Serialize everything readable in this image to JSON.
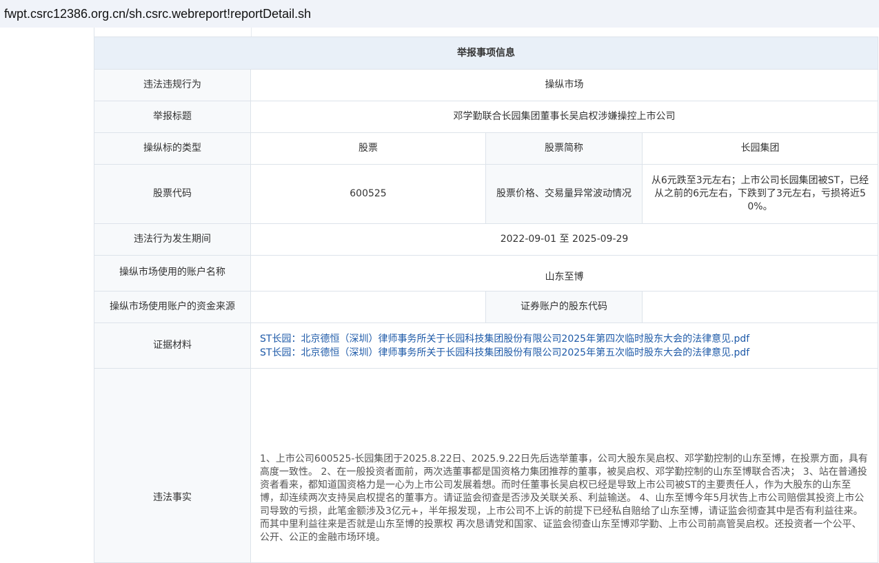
{
  "browser": {
    "url": "fwpt.csrc12386.org.cn/sh.csrc.webreport!reportDetail.sh"
  },
  "report": {
    "section_title": "举报事项信息",
    "violation_type": {
      "label": "违法违规行为",
      "value": "操纵市场"
    },
    "title": {
      "label": "举报标题",
      "value": "邓学勤联合长园集团董事长吴启权涉嫌操控上市公司"
    },
    "target_type": {
      "label": "操纵标的类型",
      "value": "股票",
      "abbr_label": "股票简称",
      "abbr_value": "长园集团"
    },
    "stock_code": {
      "label": "股票代码",
      "value": "600525",
      "anomaly_label": "股票价格、交易量异常波动情况",
      "anomaly_value": "从6元跌至3元左右；上市公司长园集团被ST，已经从之前的6元左右，下跌到了3元左右，亏损将近50%。"
    },
    "period": {
      "label": "违法行为发生期间",
      "value": "2022-09-01 至 2025-09-29"
    },
    "account_name": {
      "label": "操纵市场使用的账户名称",
      "value": "山东至博"
    },
    "fund_source": {
      "label": "操纵市场使用账户的资金来源",
      "value": "",
      "holder_code_label": "证券账户的股东代码",
      "holder_code_value": ""
    },
    "evidence": {
      "label": "证据材料",
      "files": [
        "ST长园：北京德恒（深圳）律师事务所关于长园科技集团股份有限公司2025年第四次临时股东大会的法律意见.pdf",
        "ST长园：北京德恒（深圳）律师事务所关于长园科技集团股份有限公司2025年第五次临时股东大会的法律意见.pdf"
      ]
    },
    "facts": {
      "label": "违法事实",
      "value": "1、上市公司600525-长园集团于2025.8.22日、2025.9.22日先后选举董事，公司大股东吴启权、邓学勤控制的山东至博，在投票方面，具有高度一致性。 2、在一般投资者面前，两次选董事都是国资格力集团推荐的董事，被吴启权、邓学勤控制的山东至博联合否决； 3、站在普通投资者看来，都知道国资格力是一心为上市公司发展着想。而时任董事长吴启权已经是导致上市公司被ST的主要责任人，作为大股东的山东至博，却连续两次支持吴启权提名的董事方。请证监会彻查是否涉及关联关系、利益输送。 4、山东至博今年5月状告上市公司赔偿其投资上市公司导致的亏损，此笔金额涉及3亿元+，半年报发现，上市公司不上诉的前提下已经私自赔给了山东至博，请证监会彻查其中是否有利益往来。而其中里利益往来是否就是山东至博的投票权 再次恳请党和国家、证监会彻查山东至博邓学勤、上市公司前高管吴启权。还投资者一个公平、公开、公正的金融市场环境。"
    }
  }
}
